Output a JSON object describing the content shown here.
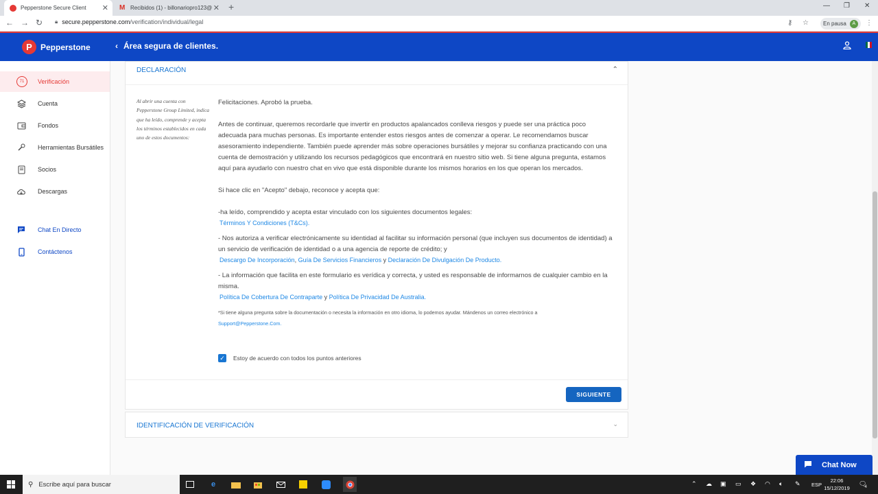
{
  "browser": {
    "tabs": [
      {
        "title": "Pepperstone Secure Client",
        "active": true
      },
      {
        "title": "Recibidos (1) - billonariopro123@",
        "active": false
      }
    ],
    "url_host": "secure.pepperstone.com",
    "url_path": "/verification/individual/legal",
    "pause_label": "En pausa",
    "avatar_letter": "A"
  },
  "header": {
    "brand": "Pepperstone",
    "logo_letter": "P",
    "title": "Área segura de clientes."
  },
  "sidebar": {
    "badge": "71",
    "items": [
      {
        "label": "Verificación",
        "icon": "verification-badge-icon"
      },
      {
        "label": "Cuenta",
        "icon": "layers-icon"
      },
      {
        "label": "Fondos",
        "icon": "wallet-icon"
      },
      {
        "label": "Herramientas Bursátiles",
        "icon": "wrench-icon"
      },
      {
        "label": "Socios",
        "icon": "partners-icon"
      },
      {
        "label": "Descargas",
        "icon": "cloud-download-icon"
      },
      {
        "label": "Chat En Directo",
        "icon": "chat-icon"
      },
      {
        "label": "Contáctenos",
        "icon": "phone-icon"
      }
    ]
  },
  "declaration": {
    "title": "DECLARACIÓN",
    "note": "Al abrir una cuenta con Pepperstone Group Limited, indica que ha leído, comprende y acepta los términos establecidos en cada uno de estos documentos:",
    "p1": "Felicitaciones. Aprobó la prueba.",
    "p2": "Antes de continuar, queremos recordarle que invertir en productos apalancados conlleva riesgos y puede ser una práctica poco adecuada para muchas personas. Es importante entender estos riesgos antes de comenzar a operar. Le recomendamos buscar asesoramiento independiente. También puede aprender más sobre operaciones bursátiles y mejorar su confianza practicando con una cuenta de demostración y utilizando los recursos pedagógicos que encontrará en nuestro sitio web. Si tiene alguna pregunta, estamos aquí para ayudarlo con nuestro chat en vivo que está disponible durante los mismos horarios en los que operan los mercados.",
    "p3": "Si hace clic en \"Acepto\" debajo, reconoce y acepta que:",
    "b1": "-ha leído, comprendido y acepta estar vinculado con los siguientes documentos legales:",
    "b1_link": "Términos Y Condiciones (T&Cs).",
    "b2": "- Nos autoriza a verificar electrónicamente su identidad al facilitar su información personal (que incluyen sus documentos de identidad) a un servicio de verificación de identidad o a una agencia de reporte de crédito; y",
    "b2_link1": "Descargo De Incorporación",
    "b2_sep1": ", ",
    "b2_link2": "Guía De Servicios Financieros",
    "b2_sep2": " y ",
    "b2_link3": "Declaración De Divulgación De Producto",
    "b2_end": ".",
    "b3": "- La información que facilita en este formulario es verídica y correcta, y usted es responsable de informarnos de cualquier cambio en la misma.",
    "b3_link1": "Política De Cobertura De Contraparte",
    "b3_sep": " y ",
    "b3_link2": "Política De Privacidad De Australia",
    "b3_end": ".",
    "small": "*Si tiene alguna pregunta sobre la documentación o necesita la información en otro idioma, lo podemos ayudar. Mándenos un correo electrónico a",
    "email": "Support@Pepperstone.Com.",
    "agree_label": "Estoy de acuerdo con todos los puntos anteriores",
    "agree_checked": true,
    "next_button": "SIGUIENTE"
  },
  "verification_section": {
    "title": "IDENTIFICACIÓN DE VERIFICACIÓN"
  },
  "chat": {
    "label": "Chat Now"
  },
  "taskbar": {
    "search_placeholder": "Escribe aquí para buscar",
    "lang": "ESP",
    "time": "22:06",
    "date": "15/12/2019",
    "notifications": "4"
  },
  "colors": {
    "brand_blue": "#0e47c5",
    "brand_red": "#e53935",
    "link_blue": "#1e88e5"
  }
}
